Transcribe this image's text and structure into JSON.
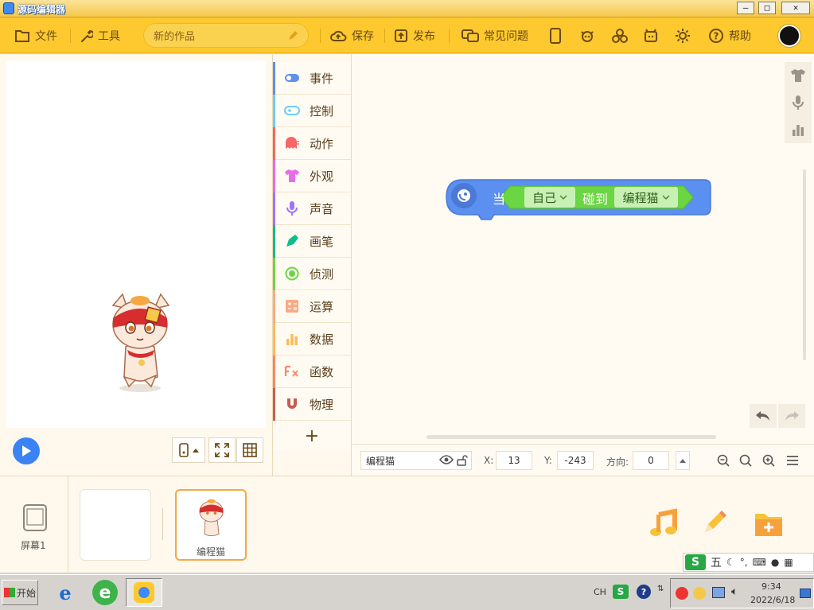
{
  "window": {
    "title": "源码编辑器",
    "btn_min": "—",
    "btn_max": "□",
    "btn_close": "✕"
  },
  "toolbar": {
    "file": "文件",
    "tools": "工具",
    "project_name": "新的作品",
    "save": "保存",
    "publish": "发布",
    "faq": "常见问题",
    "help": "帮助"
  },
  "palette": [
    {
      "label": "事件",
      "color": "#608fee"
    },
    {
      "label": "控制",
      "color": "#68cdff"
    },
    {
      "label": "动作",
      "color": "#f46767"
    },
    {
      "label": "外观",
      "color": "#e76cea"
    },
    {
      "label": "声音",
      "color": "#a073ff"
    },
    {
      "label": "画笔",
      "color": "#0fbd8c"
    },
    {
      "label": "侦测",
      "color": "#6cd543"
    },
    {
      "label": "运算",
      "color": "#f8aa87"
    },
    {
      "label": "数据",
      "color": "#ffbb55"
    },
    {
      "label": "函数",
      "color": "#f88767"
    },
    {
      "label": "物理",
      "color": "#c55e55"
    }
  ],
  "palette_add": "+",
  "block": {
    "when": "当",
    "self": "自己",
    "touch": "碰到",
    "target": "编程猫"
  },
  "sprite_info": {
    "name": "编程猫",
    "x_label": "X:",
    "x_value": "13",
    "y_label": "Y:",
    "y_value": "-243",
    "dir_label": "方向:",
    "dir_value": "0"
  },
  "bottom": {
    "screen_label": "屏幕1",
    "sprite_label": "编程猫"
  },
  "taskbar": {
    "start": "开始",
    "ime_lang": "CH",
    "ime_mode": "五",
    "time": "9:34",
    "date": "2022/6/18"
  },
  "colors": {
    "toolbar": "#fdc92e",
    "event_block": "#5b8ff0",
    "sensing_block": "#6cd543",
    "accent_border": "#f5a742"
  }
}
